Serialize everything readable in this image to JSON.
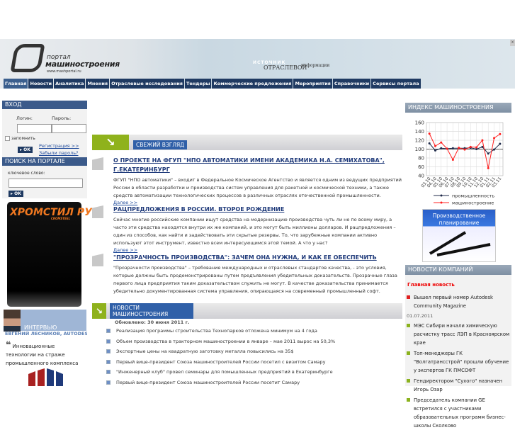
{
  "header": {
    "logo_top": "портал",
    "logo_main": "машиностроения",
    "logo_url": "www.mashportal.ru",
    "tagline_1": "ИСТОЧНИК",
    "tagline_2": "ОТРАСЛЕВОЙ",
    "tagline_3": "информации",
    "close": "x"
  },
  "nav": [
    "Главная",
    "Новости",
    "Аналитика",
    "Мнения",
    "Отраслевые исследования",
    "Тендеры",
    "Коммерческие предложения",
    "Мероприятия",
    "Справочники",
    "Сервисы портала"
  ],
  "login": {
    "title": "ВХОД",
    "login_label": "Логин:",
    "password_label": "Пароль:",
    "remember": "запомнить",
    "ok": "▸ OK",
    "register": "Регистрация >>",
    "forgot": "Забыли пароль? >>"
  },
  "search": {
    "title": "ПОИСК НА ПОРТАЛЕ",
    "keyword_label": "ключевое слово:",
    "ok": "▸ OK"
  },
  "ad": {
    "title": "ХРОМСТИЛ РУ",
    "subtitle": "CROMSTEEL"
  },
  "interview": {
    "label": "ИНТЕРВЬЮ",
    "name": "ЕВГЕНИЙ ЛЕСНИКОВ, AUTODESK CIS:",
    "quote_mark": "❝",
    "quote": "Инновационные технологии на страже промышленного комплекса"
  },
  "fresh": {
    "title": "СВЕЖИЙ ВЗГЛЯД",
    "more": "Далее >>",
    "articles": [
      {
        "title": "О ПРОЕКТЕ НА ФГУП \"НПО АВТОМАТИКИ ИМЕНИ АКАДЕМИКА Н.А. СЕМИХАТОВА\", Г.ЕКАТЕРИНБУРГ",
        "text": "ФГУП \"НПО автоматики\" – входит в Федеральное Космическое Агентство и является одним из ведущих предприятий России в области разработки и производства систем управления для ракетной и космической техники, а также средств автоматизации технологических процессов в различных отраслях отечественной промышленности."
      },
      {
        "title": "РАЦПРЕДЛОЖЕНИЯ В РОССИИ. ВТОРОЕ РОЖДЕНИЕ",
        "text": "Сейчас многие российские компании ищут средства на модернизацию производства чуть ли не по всему миру, а часто эти средства находятся внутри их же компаний, и это могут быть миллионы долларов. И рацпредложения – один из способов, как найти и задействовать эти скрытые резервы. То, что зарубежные компании активно используют этот инструмент, известно всем интересующимся этой темой. А что у нас?"
      },
      {
        "title": "\"ПРОЗРАЧНОСТЬ ПРОИЗВОДСТВА\": ЗАЧЕМ ОНА НУЖНА, И КАК ЕЕ ОБЕСПЕЧИТЬ",
        "text": "\"Прозрачности производства\" – требование международных и отраслевых стандартов качества, - это условия, которые должны быть продемонстрированы путем предъявления убедительных доказательств. Прозрачные глаза первого лица предприятия таким доказательством служить не могут. В качестве доказательства принимается убедительно документированная система управления, опирающаяся на современный промышленный софт."
      }
    ]
  },
  "news": {
    "title": "НОВОСТИ МАШИНОСТРОЕНИЯ",
    "updated": "Обновлено: 30 июня 2011 г.",
    "items": [
      "Реализация программы строительства Технопарков отложена минимум на 4 года",
      "Объем производства в тракторном машиностроении в январе – мае 2011 вырос на 50,3%",
      "Экспортные цены на квадратную заготовку металла повысились на 35$",
      "Первый вице-президент Союза машиностроителей России посетил с визитом Самару",
      "\"Инженерный клуб\" провел семинары для помышленных предприятий в Екатеринбурге",
      "Первый вице-президент Союза машиностроителей России посетит Самару"
    ]
  },
  "index": {
    "title": "ИНДЕКС МАШИНОСТРОЕНИЯ"
  },
  "chart_data": {
    "type": "line",
    "title": "",
    "categories": [
      "03.10",
      "04.10",
      "05.10",
      "06.10",
      "07.10",
      "08.10",
      "09.10",
      "10.10",
      "11.10",
      "12.10",
      "01.11",
      "02.11",
      "03.11"
    ],
    "ylim": [
      40,
      160
    ],
    "yticks": [
      "40",
      "60",
      "80",
      "100",
      "120",
      "140",
      "160"
    ],
    "grid": true,
    "legend": "bottom",
    "series": [
      {
        "name": "промышленность",
        "color": "#1f2a4a",
        "values": [
          113,
          97,
          102,
          101,
          102,
          102,
          102,
          103,
          100,
          105,
          90,
          99,
          112
        ]
      },
      {
        "name": "машиностроение",
        "color": "#ff2020",
        "values": [
          135,
          107,
          115,
          101,
          76,
          103,
          99,
          105,
          104,
          120,
          57,
          125,
          134
        ]
      }
    ]
  },
  "promo": {
    "text": "Производственное планирование"
  },
  "companies": {
    "title": "НОВОСТИ КОМПАНИЙ",
    "main_label": "Главная новость",
    "main_item": "Вышел первый номер Autodesk Community Magazine",
    "date": "01.07.2011",
    "items": [
      "МЭС Сибири начали химическую расчистку трасс ЛЭП в Красноярском крае",
      "Топ-менеджеры ГК \"Волгатрансстрой\" прошли обучение у экспертов ГК ПМСОФТ",
      "Гендиректором \"Сухого\" назначен Игорь Озар",
      "Председатель компании GE встретился с участниками образовательных программ бизнес-школы Сколково"
    ]
  }
}
